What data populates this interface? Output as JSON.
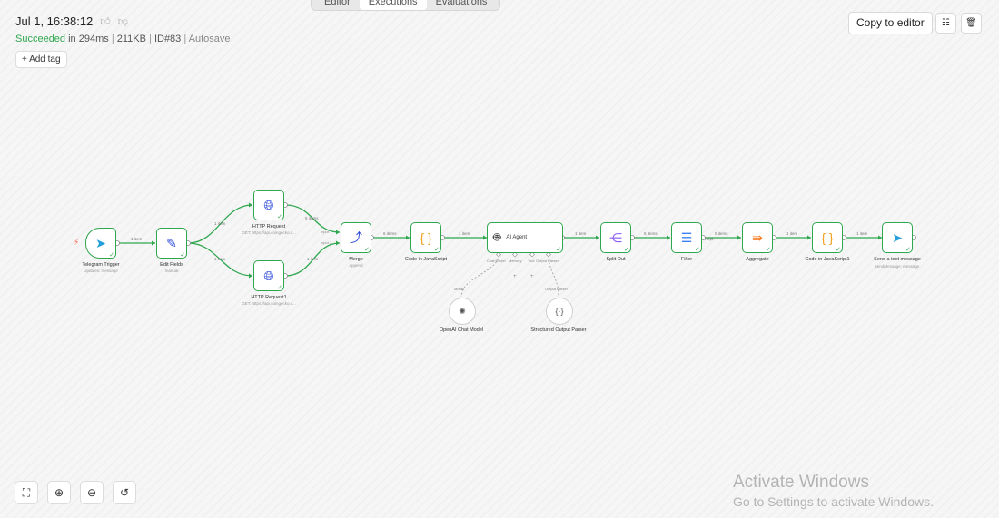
{
  "header": {
    "tabs": [
      "Editor",
      "Executions",
      "Evaluations"
    ],
    "execution_date": "Jul 1, 16:38:12",
    "status": "Succeeded",
    "duration": "in 294ms",
    "size": "211KB",
    "execution_id": "ID#83",
    "mode": "Autosave",
    "add_tag_label": "+ Add tag",
    "copy_to_editor_label": "Copy to editor"
  },
  "colors": {
    "success": "#2ea74f",
    "trigger_icon": "#ff6d5a",
    "http": "#2b48d8",
    "code": "#f0a020",
    "split": "#8b5cf6",
    "filter": "#3b82f6",
    "aggregate": "#f97316",
    "telegram": "#229ed9"
  },
  "workflow": {
    "nodes": [
      {
        "name": "Telegram Trigger",
        "subtitle": "Updates: message",
        "icon": "telegram-icon"
      },
      {
        "name": "Edit Fields",
        "subtitle": "manual",
        "icon": "pencil-icon"
      },
      {
        "name": "HTTP Request",
        "subtitle": "GET: https://api.coingecko.c...",
        "icon": "globe-icon"
      },
      {
        "name": "HTTP Request1",
        "subtitle": "GET: https://api.coingecko.c...",
        "icon": "globe-icon"
      },
      {
        "name": "Merge",
        "subtitle": "append",
        "icon": "merge-icon"
      },
      {
        "name": "Code in JavaScript",
        "subtitle": "",
        "icon": "braces-icon"
      },
      {
        "name": "AI Agent",
        "subtitle": "",
        "icon": "robot-icon"
      },
      {
        "name": "Split Out",
        "subtitle": "",
        "icon": "split-icon"
      },
      {
        "name": "Filter",
        "subtitle": "",
        "icon": "filter-icon"
      },
      {
        "name": "Aggregate",
        "subtitle": "",
        "icon": "aggregate-icon"
      },
      {
        "name": "Code in JavaScript1",
        "subtitle": "",
        "icon": "braces-icon"
      },
      {
        "name": "Send a text message",
        "subtitle": "sendMessage: message",
        "icon": "telegram-icon"
      }
    ],
    "sub_nodes": [
      {
        "name": "OpenAI Chat Model",
        "port": "Model",
        "icon": "openai-icon"
      },
      {
        "name": "Structured Output Parser",
        "port": "Output Parser",
        "icon": "parser-icon"
      }
    ],
    "agent_ports": [
      "Chat Model",
      "Memory",
      "Tool",
      "Output Parser"
    ],
    "merge_inputs": [
      "Input 1",
      "Input 2"
    ],
    "edge_labels": {
      "trigger_edit": "1 item",
      "edit_http": "1 item",
      "edit_http1": "1 item",
      "http_merge": "5 items",
      "http1_merge": "1 item",
      "merge_code": "6 items",
      "code_agent": "1 item",
      "agent_split": "1 item",
      "split_filter": "5 items",
      "filter_aggregate": "5 items",
      "filter_kept": "Kept",
      "aggregate_code1": "1 item",
      "code1_send": "1 item"
    }
  },
  "watermark": {
    "line1": "Activate Windows",
    "line2": "Go to Settings to activate Windows."
  }
}
